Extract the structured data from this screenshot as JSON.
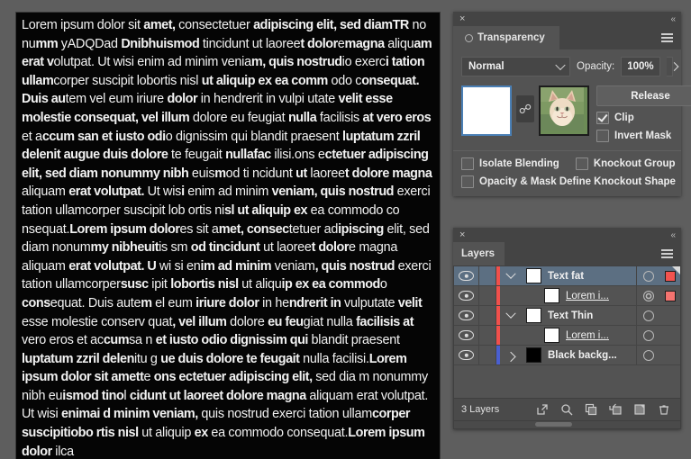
{
  "canvas": {
    "name": "artboard-text",
    "paragraph_html": "Lorem ipsum dolor sit <b>amet,</b> consectetuer <b>adipiscing elit, sed diamTR</b> no nu<b>mm</b> yADQDad <b>Dnibhuismod</b> tincidunt ut laoree<b>t dolor</b>e<b>magna</b> aliqu<b>am erat v</b>olutpat. Ut wisi enim ad minim venia<b>m, quis nostrud</b>io exerc<b>i tation ullam</b>corper suscipit lobortis nisl <b>ut aliquip ex ea comm</b> odo c<b>onsequat. Duis au</b>tem vel eum iriure <b>dolor</b> in hendrerit in vulpi utate <b>velit esse molestie consequat, vel illum</b> dolore eu feugiat <b>nulla</b> facilisis <b>at vero eros</b> et a<b>ccum san et iusto odi</b>o dignissim qui blandit praesent <b>luptatum zzril delenit augue duis dolore</b> te feugait <b>nullafac</b> ilisi.ons e<b>ctetuer adipiscing elit, sed diam nonummy nibh</b> euis<b>m</b>od ti ncidunt <b>ut</b> laoree<b>t dolore magna</b> aliquam <b>erat volutpat.</b> Ut wis<b>i</b> enim ad minim <b>veniam, quis nostrud</b> exerci tation ullamcorper suscipit lob ortis ni<b>sl ut aliquip ex</b> ea commodo co nsequat.<b>Lorem ipsum dolor</b>es sit a<b>met, consec</b>tetuer ad<b>ipiscing</b> elit, sed diam nonum<b>my nibheuit</b>is sm <b>od tincidunt</b> ut laoree<b>t dolor</b>e magna aliquam <b>erat volutpat. U</b> wi si en<b>im ad minim</b> veniam<b>, quis nostrud</b> exerci tation ullamcorper<b>susc</b> ipit <b>lobortis nisl</b> ut aliqu<b>ip ex ea commod</b>o <b>cons</b>equat. Duis aute<b>m</b> el eum <b>iriure dolor</b> in he<b>ndrerit in</b> vulputate <b>velit</b> esse molestie conserv quat<b>, vel illum</b> dolore <b>eu feu</b>giat nulla <b>facilisis at</b> vero eros et ac<b>cum</b>sa n <b>et iusto odio dignissim qui</b> blandit praesent <b>luptatum zzril delen</b>itu g <b>ue duis dolore te feugait</b> nulla facilisi.<b>Lorem ipsum dolor sit amett</b>e <b>ons ectetuer adipiscing elit,</b> sed dia m nonummy nibh eu<b>ismod tino</b>l <b>cidunt ut laoreet dolore magna</b> aliquam erat volutpat. Ut wisi <b>enimai d minim veniam,</b> quis nostrud exerci tation ullam<b>corper suscipitiobo rtis nisl</b> ut aliquip <b>ex</b> ea commodo consequat.<b>Lorem ipsum dolor</b> ilca"
  },
  "transparency": {
    "panel_name": "Transparency",
    "close_icon": "×",
    "collapse_icon": "«",
    "tab_label": "Transparency",
    "blend_mode": "Normal",
    "opacity_label": "Opacity:",
    "opacity_value": "100%",
    "release_label": "Release",
    "clip_label": "Clip",
    "clip_checked": true,
    "invert_mask_label": "Invert Mask",
    "invert_mask_checked": false,
    "isolate_blending_label": "Isolate Blending",
    "isolate_blending_checked": false,
    "knockout_group_label": "Knockout Group",
    "knockout_group_checked": false,
    "opacity_mask_label": "Opacity & Mask Define Knockout Shape",
    "opacity_mask_checked": false,
    "accent_color": "#4a7fb5"
  },
  "layers": {
    "panel_name": "Layers",
    "close_icon": "×",
    "collapse_icon": "«",
    "tab_label": "Layers",
    "count_label": "3 Layers",
    "selected_color": "#5c6f82",
    "rows": [
      {
        "name": "Text fat",
        "indent": 0,
        "twisty": "open",
        "thumb": "white",
        "color": "#f0504c",
        "selected": true,
        "sub": false,
        "target": "single",
        "sel_square": true,
        "sel_square_light": false
      },
      {
        "name": "Lorem i...",
        "indent": 1,
        "twisty": "none",
        "thumb": "white",
        "color": "#f0504c",
        "selected": false,
        "sub": true,
        "target": "double",
        "sel_square": true,
        "sel_square_light": true
      },
      {
        "name": "Text Thin",
        "indent": 0,
        "twisty": "open",
        "thumb": "white",
        "color": "#f0504c",
        "selected": false,
        "sub": false,
        "target": "single",
        "sel_square": false,
        "sel_square_light": false
      },
      {
        "name": "Lorem i...",
        "indent": 1,
        "twisty": "none",
        "thumb": "white",
        "color": "#f0504c",
        "selected": false,
        "sub": true,
        "target": "single",
        "sel_square": false,
        "sel_square_light": false
      },
      {
        "name": "Black backg...",
        "indent": 0,
        "twisty": "closed",
        "thumb": "black",
        "color": "#4a5fd0",
        "selected": false,
        "sub": false,
        "target": "single",
        "sel_square": false,
        "sel_square_light": false
      }
    ],
    "footer_icons": [
      "make-clipping-mask-icon",
      "locate-object-icon",
      "new-sublayer-icon",
      "release-to-layers-icon",
      "new-layer-icon",
      "delete-layer-icon"
    ]
  }
}
